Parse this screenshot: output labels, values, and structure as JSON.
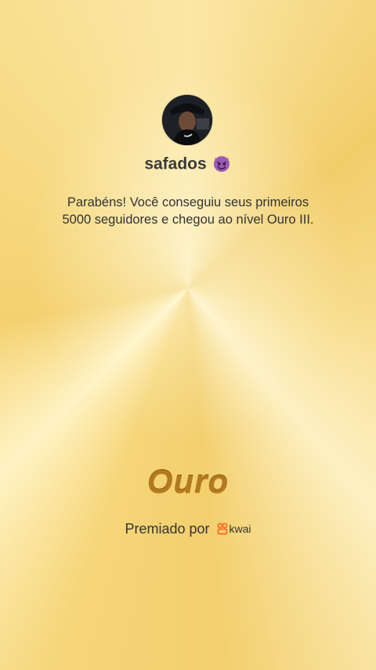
{
  "profile": {
    "avatar_icon": "user-avatar",
    "username": "safados",
    "username_emoji_icon": "smiling-devil-icon"
  },
  "message": {
    "line1": "Parabéns! Você conseguiu seus primeiros",
    "line2": "5000 seguidores e chegou ao nível Ouro III."
  },
  "tier": {
    "label": "Ouro",
    "color": "#b27a1e"
  },
  "award": {
    "prefix": "Premiado por",
    "brand_icon": "kwai-logo-icon",
    "brand": "kwai",
    "brand_color": "#ff6a1f"
  },
  "colors": {
    "background": "#f6d67a",
    "text": "#333333"
  }
}
